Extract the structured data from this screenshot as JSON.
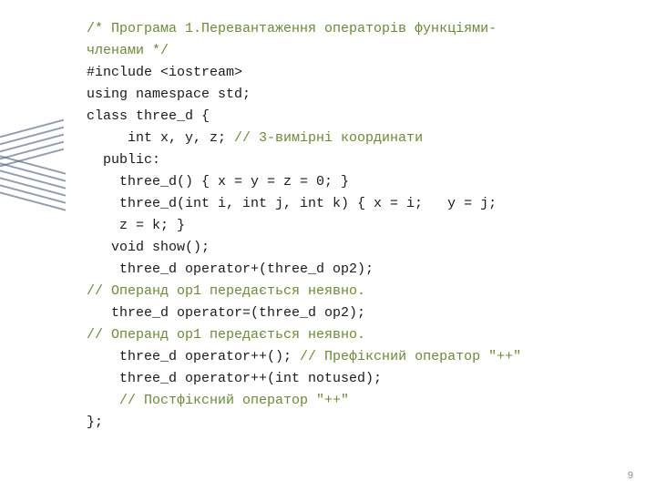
{
  "code": {
    "l1": "/* Програма 1.Перевантаження операторів функціями-",
    "l2": "членами */",
    "l3a": "#include ",
    "l3b": "<iostream>",
    "l4": "using namespace std;",
    "l5": "class three_d {",
    "l6a": "     int x, y, z; ",
    "l6b": "// 3-вимірні координати",
    "l7": "  public:",
    "l8": "    three_d() { x = y = z = 0; }",
    "l9": "    three_d(int i, int j, int k) { x = i;   y = j;",
    "l10": "    z = k; }",
    "l11": "   void show();",
    "l12": "    three_d operator+(three_d op2);",
    "l13": "// Операнд op1 передається неявно.",
    "l14": "   three_d operator=(three_d op2);",
    "l15": "// Операнд op1 передається неявно.",
    "l16a": "    three_d operator++(); ",
    "l16b": "// Префіксний оператор \"++\"",
    "l17": "    three_d operator++(int notused);",
    "l18": "    // Постфіксний оператор \"++\"",
    "l19": "};"
  },
  "page_number": "9"
}
